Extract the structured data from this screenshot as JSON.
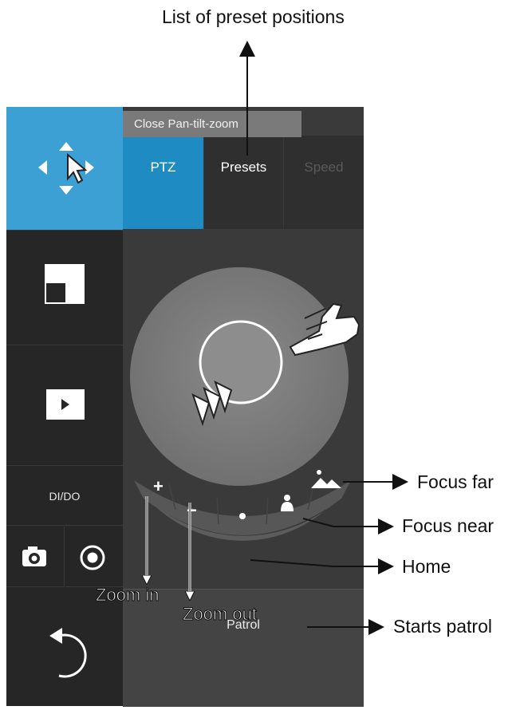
{
  "callouts": {
    "list_of_presets": "List of preset positions",
    "focus_far": "Focus far",
    "focus_near": "Focus near",
    "home": "Home",
    "starts_patrol": "Starts patrol",
    "zoom_in": "Zoom in",
    "zoom_out": "Zoom out"
  },
  "tooltip": "Close Pan-tilt-zoom",
  "tabs": [
    {
      "label": "PTZ",
      "state": "active"
    },
    {
      "label": "Presets",
      "state": "normal"
    },
    {
      "label": "Speed",
      "state": "disabled"
    }
  ],
  "left_menu": {
    "dido_label": "DI/DO"
  },
  "ptz_controls": {
    "zoom_in_symbol": "+",
    "zoom_out_symbol": "−",
    "home_symbol": "•"
  },
  "patrol_label": "Patrol",
  "colors": {
    "accent_blue": "#3da0d4",
    "tab_active": "#1e8bc3",
    "panel_dark": "#262626",
    "panel_mid": "#3a3a3a"
  }
}
